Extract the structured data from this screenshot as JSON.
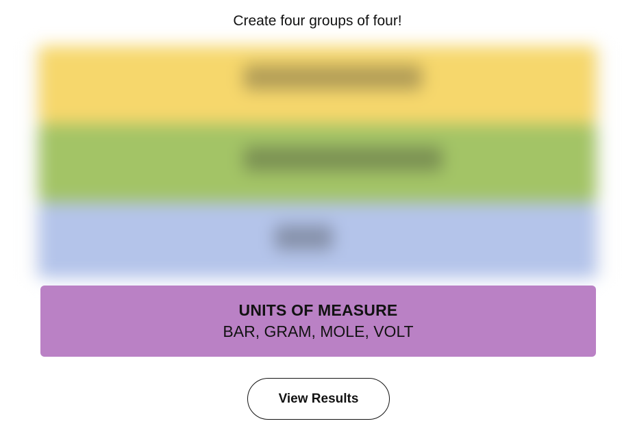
{
  "game": {
    "instructions": "Create four groups of four!",
    "hidden_rows": [
      {
        "color_name": "yellow",
        "color": "#f6d76c"
      },
      {
        "color_name": "green",
        "color": "#a3c466"
      },
      {
        "color_name": "blue",
        "color": "#b4c4ea"
      }
    ],
    "revealed_group": {
      "title": "UNITS OF MEASURE",
      "members": "BAR, GRAM, MOLE, VOLT",
      "color": "#ba81c5"
    },
    "results_button_label": "View Results"
  }
}
